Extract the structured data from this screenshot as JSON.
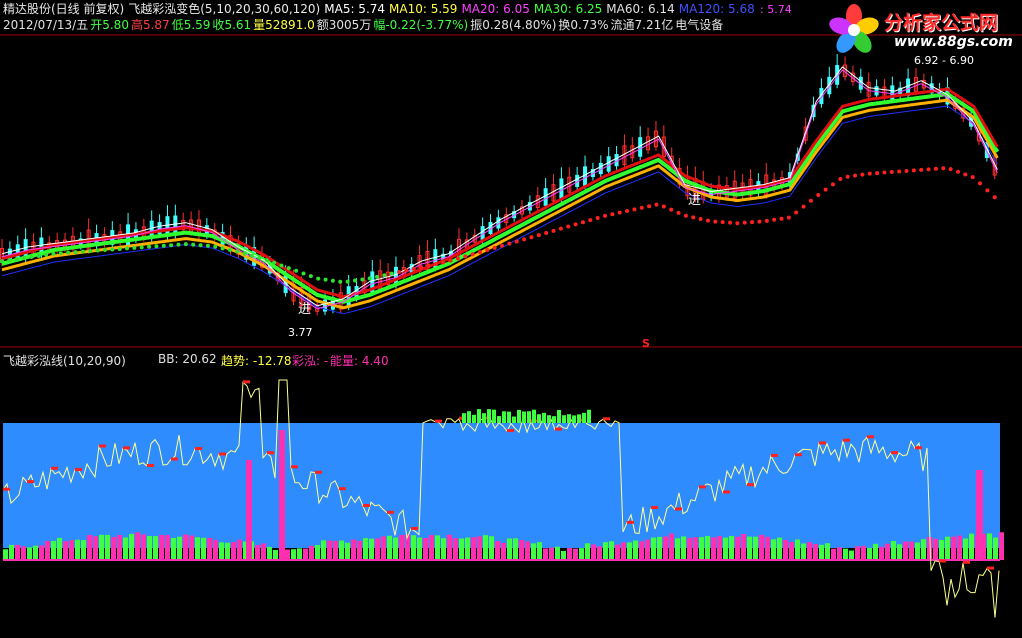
{
  "header": {
    "stock": "精达股份(日线 前复权)",
    "indicator": "飞越彩泓变色(5,10,20,30,60,120)",
    "ma5_label": "MA5: 5.74",
    "ma10_label": "MA10: 5.59",
    "ma20_label": "MA20: 6.05",
    "ma30_label": "MA30: 6.25",
    "ma60_label": "MA60: 6.14",
    "ma120_label": "MA120: 5.68",
    "price_marker": ": 5.74",
    "date": "2012/07/13/五",
    "open_label": "开",
    "open_value": "5.80",
    "high_label": "高",
    "high_value": "5.87",
    "low_label": "低",
    "low_value": "5.59",
    "close_label": "收",
    "close_value": "5.61",
    "volume": "量52891.0",
    "amount": "额3005万",
    "change_label": "幅-0.22(-3.77%)",
    "amplitude": "振0.28(4.80%)",
    "turnover": "换0.73%",
    "float": "流通7.21亿",
    "sector": "电气设备"
  },
  "logo": {
    "title": "分析家公式网",
    "url": "www.88gs.com"
  },
  "main_panel": {
    "high_tag": "6.92 - 6.90",
    "low_tag": "3.77",
    "entry_label": "进",
    "s_marker": "S"
  },
  "sub_panel": {
    "title": "飞越彩泓线(10,20,90)",
    "bb": "BB: 20.62",
    "trend": "趋势: -12.78",
    "caihong": "彩泓: -",
    "energy": "能量: 4.40"
  },
  "colors": {
    "bg": "#000000",
    "ma_red": "#e01010",
    "ma_green": "#30ff30",
    "ma_orange": "#ffb000",
    "ma_white": "#ffffff",
    "ma_blue": "#2030ff",
    "band_blue": "#2f8cff",
    "bar_green": "#40ff40",
    "bar_pink": "#ff30b0",
    "dot_red": "#ff2020",
    "dot_green": "#30e030"
  },
  "chart_data": {
    "type": "line",
    "title": "",
    "series": [
      {
        "values": [
          4.6,
          4.7,
          4.75,
          4.8,
          4.85,
          4.9,
          5.0,
          5.05,
          4.95,
          4.7,
          4.5,
          4.1,
          3.85,
          3.95,
          4.2,
          4.3,
          4.5,
          4.6,
          4.85,
          5.1,
          5.3,
          5.5,
          5.7,
          5.9,
          6.1,
          6.3,
          5.6,
          5.5,
          5.55,
          5.6,
          5.7,
          6.8,
          7.3,
          7.0,
          6.95,
          7.1,
          6.9,
          6.5,
          5.74
        ]
      },
      {
        "values": [
          4.5,
          4.6,
          4.7,
          4.75,
          4.8,
          4.85,
          4.9,
          4.95,
          4.9,
          4.75,
          4.55,
          4.3,
          4.05,
          3.95,
          4.05,
          4.2,
          4.35,
          4.5,
          4.7,
          4.9,
          5.1,
          5.3,
          5.5,
          5.7,
          5.85,
          6.0,
          5.7,
          5.55,
          5.5,
          5.55,
          5.65,
          6.2,
          6.7,
          6.8,
          6.85,
          6.9,
          6.95,
          6.7,
          6.05
        ]
      }
    ],
    "xlim": [
      0,
      38
    ],
    "ylim": [
      3.5,
      7.5
    ]
  }
}
